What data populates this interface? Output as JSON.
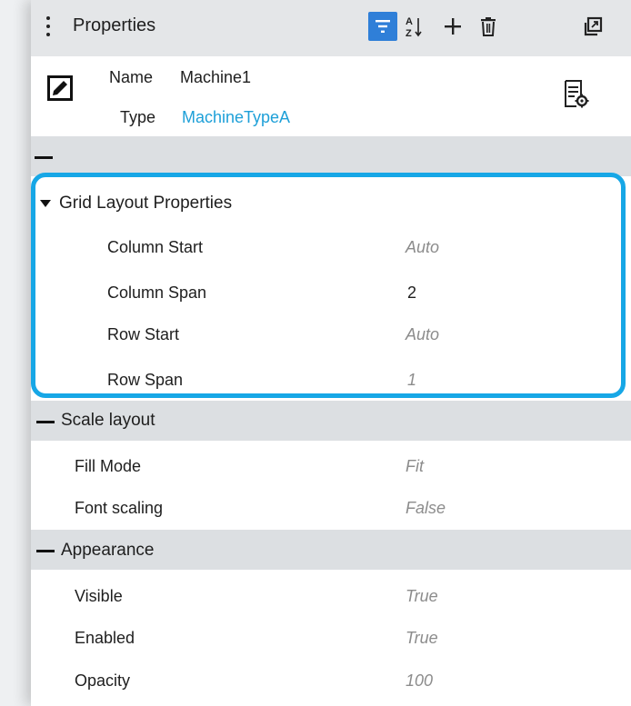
{
  "panel": {
    "title": "Properties"
  },
  "toolbar": {
    "buttons": [
      {
        "name": "sort-by-category",
        "icon": "sort-lines-icon",
        "active": true
      },
      {
        "name": "sort-alphabetical",
        "icon": "sort-az-icon",
        "a": "A",
        "z": "Z"
      },
      {
        "name": "add",
        "icon": "plus-icon"
      },
      {
        "name": "delete",
        "icon": "trash-icon"
      },
      {
        "name": "detach",
        "icon": "popout-icon"
      }
    ]
  },
  "object": {
    "name_label": "Name",
    "name_value": "Machine1",
    "type_label": "Type",
    "type_value": "MachineTypeA"
  },
  "colors": {
    "accent": "#2f7fd8",
    "link": "#1ea0d8",
    "highlight": "#17a7e6",
    "header_bg": "#e4e6e8",
    "group_bg": "#dcdfe2",
    "muted_value": "#8c8c8c"
  },
  "groups": {
    "grid_layout": {
      "title": "Grid Layout Properties",
      "rows": [
        {
          "label": "Column Start",
          "value": "Auto",
          "default": true
        },
        {
          "label": "Column Span",
          "value": "2",
          "default": false
        },
        {
          "label": "Row Start",
          "value": "Auto",
          "default": true
        },
        {
          "label": "Row Span",
          "value": "1",
          "default": true
        }
      ]
    },
    "scale_layout": {
      "title": "Scale layout",
      "rows": [
        {
          "label": "Fill Mode",
          "value": "Fit",
          "default": true
        },
        {
          "label": "Font scaling",
          "value": "False",
          "default": true
        }
      ]
    },
    "appearance": {
      "title": "Appearance",
      "rows": [
        {
          "label": "Visible",
          "value": "True",
          "default": true
        },
        {
          "label": "Enabled",
          "value": "True",
          "default": true
        },
        {
          "label": "Opacity",
          "value": "100",
          "default": true
        }
      ]
    }
  }
}
